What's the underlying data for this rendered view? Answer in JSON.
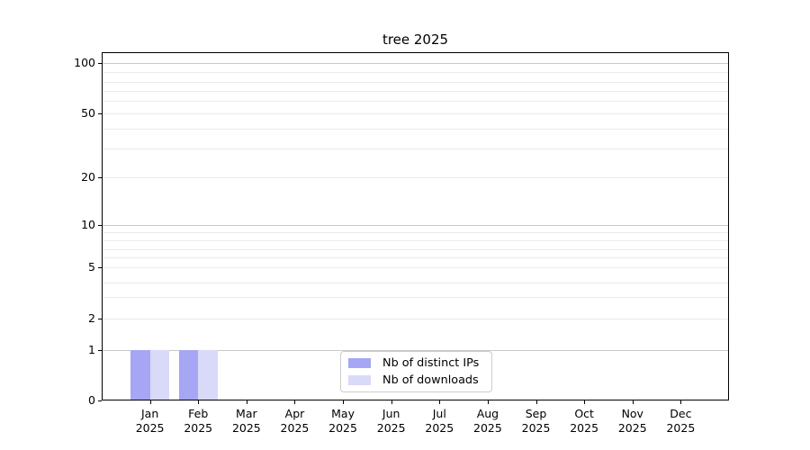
{
  "title": "tree 2025",
  "colors": {
    "distinct_ips": "#a6a6f4",
    "downloads": "#d9d9f9",
    "grid_strong": "#c8c8c8",
    "grid_weak": "#eaeaea",
    "axis": "#000000",
    "legend_border": "#cccccc"
  },
  "chart_data": {
    "type": "bar",
    "title": "tree 2025",
    "categories": [
      "Jan",
      "Feb",
      "Mar",
      "Apr",
      "May",
      "Jun",
      "Jul",
      "Aug",
      "Sep",
      "Oct",
      "Nov",
      "Dec"
    ],
    "category_year": "2025",
    "series": [
      {
        "name": "Nb of distinct IPs",
        "color_key": "distinct_ips",
        "values": [
          1,
          1,
          0,
          0,
          0,
          0,
          0,
          0,
          0,
          0,
          0,
          0
        ]
      },
      {
        "name": "Nb of downloads",
        "color_key": "downloads",
        "values": [
          1,
          1,
          0,
          0,
          0,
          0,
          0,
          0,
          0,
          0,
          0,
          0
        ]
      }
    ],
    "xlabel": "",
    "ylabel": "",
    "y_axis": {
      "scale": "log-like with linear 0-1 segment",
      "labeled_ticks": [
        0,
        1,
        2,
        5,
        10,
        20,
        50,
        100
      ],
      "minor_gridline_values": [
        3,
        4,
        6,
        7,
        8,
        9,
        30,
        40,
        60,
        70,
        80,
        90
      ],
      "range": [
        0,
        115
      ]
    },
    "grid": true,
    "legend_position": "lower center"
  },
  "legend": {
    "items": [
      {
        "label": "Nb of distinct IPs"
      },
      {
        "label": "Nb of downloads"
      }
    ]
  }
}
